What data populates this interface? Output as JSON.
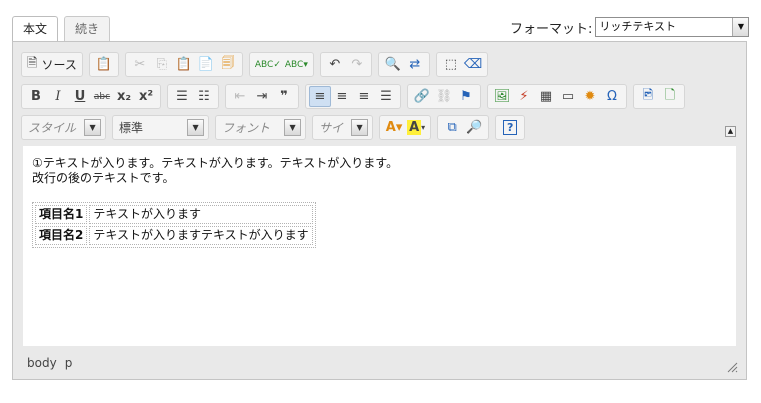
{
  "tabs": [
    {
      "label": "本文",
      "active": true
    },
    {
      "label": "続き",
      "active": false
    }
  ],
  "format": {
    "label": "フォーマット:",
    "selected": "リッチテキスト"
  },
  "toolbar": {
    "source_label": "ソース",
    "combos": {
      "style": "スタイル",
      "format": "標準",
      "font": "フォント",
      "size": "サイ"
    },
    "help": "?"
  },
  "content": {
    "line1": "①テキストが入ります。テキストが入ります。テキストが入ります。",
    "line2": "改行の後のテキストです。",
    "table": [
      [
        "項目名1",
        "テキストが入ります"
      ],
      [
        "項目名2",
        "テキストが入りますテキストが入ります"
      ]
    ]
  },
  "status": {
    "path": [
      "body",
      "p"
    ]
  }
}
